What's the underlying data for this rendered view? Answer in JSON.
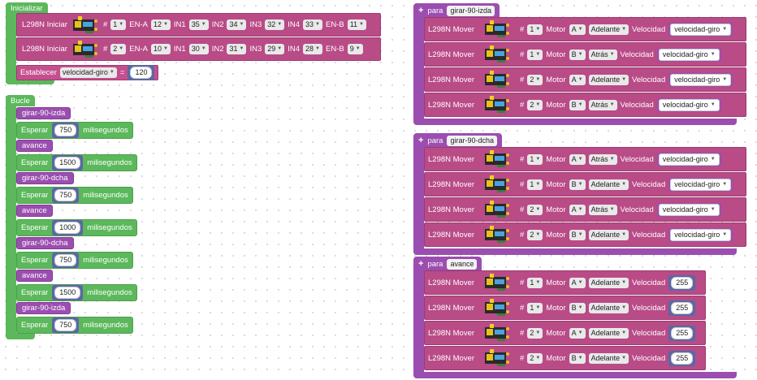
{
  "inicializar": {
    "hat": "Inicializar",
    "l298n_iniciar": [
      {
        "label": "L298N Iniciar",
        "hash": "#",
        "num": "1",
        "ena_label": "EN-A",
        "ena": "12",
        "in1_label": "IN1",
        "in1": "35",
        "in2_label": "IN2",
        "in2": "34",
        "in3_label": "IN3",
        "in3": "32",
        "in4_label": "IN4",
        "in4": "33",
        "enb_label": "EN-B",
        "enb": "11"
      },
      {
        "label": "L298N Iniciar",
        "hash": "#",
        "num": "2",
        "ena_label": "EN-A",
        "ena": "10",
        "in1_label": "IN1",
        "in1": "30",
        "in2_label": "IN2",
        "in2": "31",
        "in3_label": "IN3",
        "in3": "29",
        "in4_label": "IN4",
        "in4": "28",
        "enb_label": "EN-B",
        "enb": "9"
      }
    ],
    "establecer": {
      "label": "Establecer",
      "var": "velocidad-giro",
      "eq": "=",
      "value": "120"
    }
  },
  "bucle": {
    "hat": "Bucle",
    "esperar_label": "Esperar",
    "ms_label": "milisegundos",
    "steps": [
      {
        "call": "girar-90-izda",
        "wait": "750"
      },
      {
        "call": "avance",
        "wait": "1500"
      },
      {
        "call": "girar-90-dcha",
        "wait": "750"
      },
      {
        "call": "avance",
        "wait": "1000"
      },
      {
        "call": "girar-90-dcha",
        "wait": "750"
      },
      {
        "call": "avance",
        "wait": "1500"
      },
      {
        "call": "girar-90-izda",
        "wait": "750"
      }
    ]
  },
  "procedures": [
    {
      "para": "para",
      "name": "girar-90-izda",
      "rows": [
        {
          "label": "L298N Mover",
          "hash": "#",
          "num": "1",
          "motor_label": "Motor",
          "motor": "A",
          "dir": "Adelante",
          "vel_label": "Velocidad",
          "vel": "velocidad-giro",
          "vel_type": "var"
        },
        {
          "label": "L298N Mover",
          "hash": "#",
          "num": "1",
          "motor_label": "Motor",
          "motor": "B",
          "dir": "Atrás",
          "vel_label": "Velocidad",
          "vel": "velocidad-giro",
          "vel_type": "var"
        },
        {
          "label": "L298N Mover",
          "hash": "#",
          "num": "2",
          "motor_label": "Motor",
          "motor": "A",
          "dir": "Adelante",
          "vel_label": "Velocidad",
          "vel": "velocidad-giro",
          "vel_type": "var"
        },
        {
          "label": "L298N Mover",
          "hash": "#",
          "num": "2",
          "motor_label": "Motor",
          "motor": "B",
          "dir": "Atrás",
          "vel_label": "Velocidad",
          "vel": "velocidad-giro",
          "vel_type": "var"
        }
      ]
    },
    {
      "para": "para",
      "name": "girar-90-dcha",
      "rows": [
        {
          "label": "L298N Mover",
          "hash": "#",
          "num": "1",
          "motor_label": "Motor",
          "motor": "A",
          "dir": "Atrás",
          "vel_label": "Velocidad",
          "vel": "velocidad-giro",
          "vel_type": "var"
        },
        {
          "label": "L298N Mover",
          "hash": "#",
          "num": "1",
          "motor_label": "Motor",
          "motor": "B",
          "dir": "Adelante",
          "vel_label": "Velocidad",
          "vel": "velocidad-giro",
          "vel_type": "var"
        },
        {
          "label": "L298N Mover",
          "hash": "#",
          "num": "2",
          "motor_label": "Motor",
          "motor": "A",
          "dir": "Atrás",
          "vel_label": "Velocidad",
          "vel": "velocidad-giro",
          "vel_type": "var"
        },
        {
          "label": "L298N Mover",
          "hash": "#",
          "num": "2",
          "motor_label": "Motor",
          "motor": "B",
          "dir": "Adelante",
          "vel_label": "Velocidad",
          "vel": "velocidad-giro",
          "vel_type": "var"
        }
      ]
    },
    {
      "para": "para",
      "name": "avance",
      "rows": [
        {
          "label": "L298N Mover",
          "hash": "#",
          "num": "1",
          "motor_label": "Motor",
          "motor": "A",
          "dir": "Adelante",
          "vel_label": "Velocidad",
          "vel": "255",
          "vel_type": "num"
        },
        {
          "label": "L298N Mover",
          "hash": "#",
          "num": "1",
          "motor_label": "Motor",
          "motor": "B",
          "dir": "Adelante",
          "vel_label": "Velocidad",
          "vel": "255",
          "vel_type": "num"
        },
        {
          "label": "L298N Mover",
          "hash": "#",
          "num": "2",
          "motor_label": "Motor",
          "motor": "A",
          "dir": "Adelante",
          "vel_label": "Velocidad",
          "vel": "255",
          "vel_type": "num"
        },
        {
          "label": "L298N Mover",
          "hash": "#",
          "num": "2",
          "motor_label": "Motor",
          "motor": "B",
          "dir": "Adelante",
          "vel_label": "Velocidad",
          "vel": "255",
          "vel_type": "num"
        }
      ]
    }
  ]
}
